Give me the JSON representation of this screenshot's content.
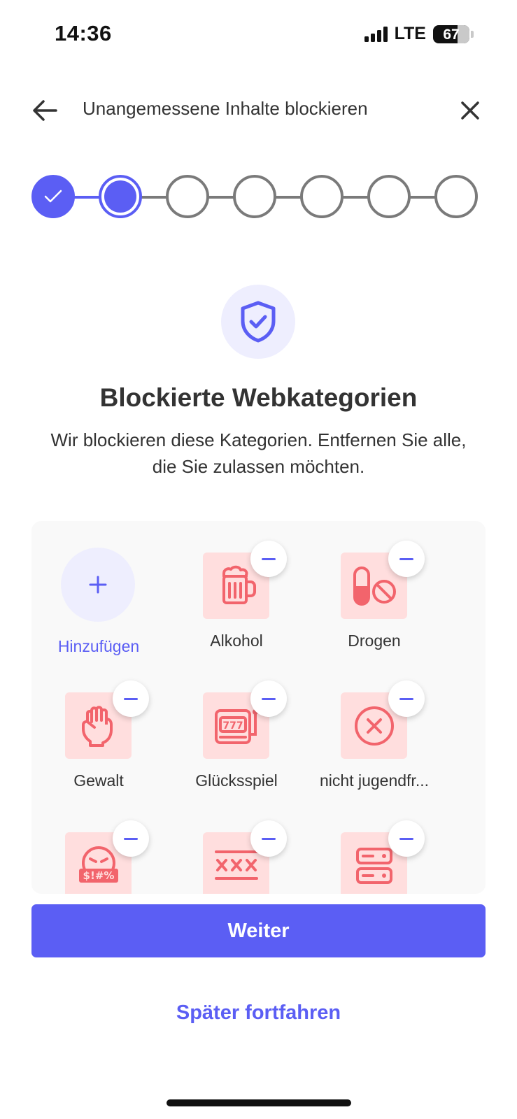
{
  "status_bar": {
    "time": "14:36",
    "network": "LTE",
    "battery": "67"
  },
  "header": {
    "back_icon": "arrow-left-icon",
    "title": "Unangemessene Inhalte blockieren",
    "close_icon": "close-icon"
  },
  "stepper": {
    "total_steps": 7,
    "completed_steps": 1,
    "current_step": 2
  },
  "hero": {
    "icon": "shield-check-icon",
    "title": "Blockierte Webkategorien",
    "subtitle": "Wir blockieren diese Kategorien. Entfernen Sie alle, die Sie zulassen möchten."
  },
  "grid": {
    "add": {
      "label": "Hinzufügen",
      "icon": "plus-icon"
    },
    "categories": [
      {
        "label": "Alkohol",
        "icon": "beer-mug-icon"
      },
      {
        "label": "Drogen",
        "icon": "pill-forbidden-icon"
      },
      {
        "label": "Gewalt",
        "icon": "fist-icon"
      },
      {
        "label": "Glücksspiel",
        "icon": "slot-machine-icon"
      },
      {
        "label": "nicht jugendfr...",
        "icon": "x-circle-icon"
      },
      {
        "label": "",
        "icon": "angry-face-icon"
      },
      {
        "label": "",
        "icon": "xxx-icon"
      },
      {
        "label": "",
        "icon": "server-icon"
      }
    ],
    "remove_icon": "minus-icon"
  },
  "actions": {
    "primary_label": "Weiter",
    "secondary_label": "Später fortfahren"
  },
  "colors": {
    "accent": "#5b5ef4",
    "accent_light": "#eeeefe",
    "category_bg": "#ffdede",
    "category_icon": "#f2646c",
    "step_inactive": "#7a7a7a"
  }
}
